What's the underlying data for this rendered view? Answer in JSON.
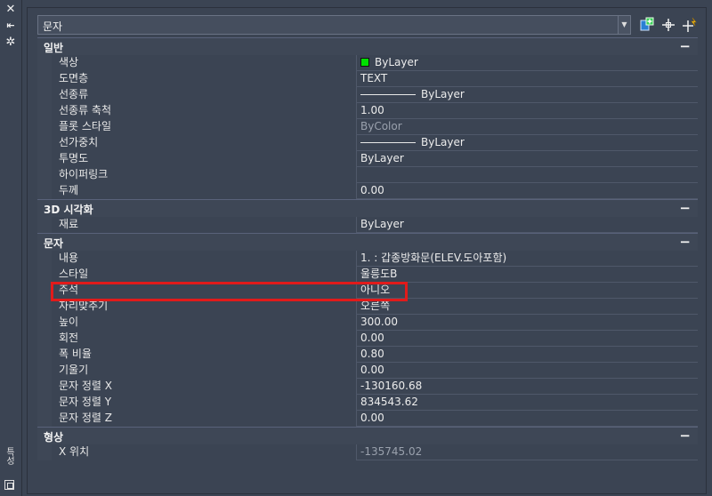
{
  "selector": {
    "value": "문자"
  },
  "sections": [
    {
      "title": "일반",
      "rows": [
        {
          "name": "색상",
          "value": "ByLayer",
          "kind": "color",
          "color": "#00e000"
        },
        {
          "name": "도면층",
          "value": "TEXT"
        },
        {
          "name": "선종류",
          "value": "ByLayer",
          "kind": "linetype"
        },
        {
          "name": "선종류 축척",
          "value": "1.00"
        },
        {
          "name": "플롯 스타일",
          "value": "ByColor",
          "dim": true
        },
        {
          "name": "선가중치",
          "value": "ByLayer",
          "kind": "linetype"
        },
        {
          "name": "투명도",
          "value": "ByLayer"
        },
        {
          "name": "하이퍼링크",
          "value": ""
        },
        {
          "name": "두께",
          "value": "0.00"
        }
      ]
    },
    {
      "title": "3D 시각화",
      "rows": [
        {
          "name": "재료",
          "value": "ByLayer"
        }
      ]
    },
    {
      "title": "문자",
      "rows": [
        {
          "name": "내용",
          "value": "1.            : 갑종방화문(ELEV.도아포함)"
        },
        {
          "name": "스타일",
          "value": "울릉도B"
        },
        {
          "name": "주석",
          "value": "아니오"
        },
        {
          "name": "자리맞추기",
          "value": "오른쪽"
        },
        {
          "name": "높이",
          "value": "300.00"
        },
        {
          "name": "회전",
          "value": "0.00"
        },
        {
          "name": "폭 비율",
          "value": "0.80"
        },
        {
          "name": "기울기",
          "value": "0.00"
        },
        {
          "name": "문자 정렬 X",
          "value": "-130160.68"
        },
        {
          "name": "문자 정렬 Y",
          "value": "834543.62"
        },
        {
          "name": "문자 정렬 Z",
          "value": "0.00"
        }
      ]
    },
    {
      "title": "형상",
      "rows": [
        {
          "name": "X 위치",
          "value": "-135745.02",
          "dim": true
        }
      ]
    }
  ],
  "collapse_symbol": "−",
  "left_strip": {
    "vertical_title": "특성"
  },
  "icons": {
    "close": "close-icon",
    "autohide": "auto-hide-icon",
    "settings": "settings-icon",
    "quick_select": "quick-select-icon",
    "select_objects": "select-objects-icon",
    "pickadd": "pickadd-toggle-icon"
  }
}
